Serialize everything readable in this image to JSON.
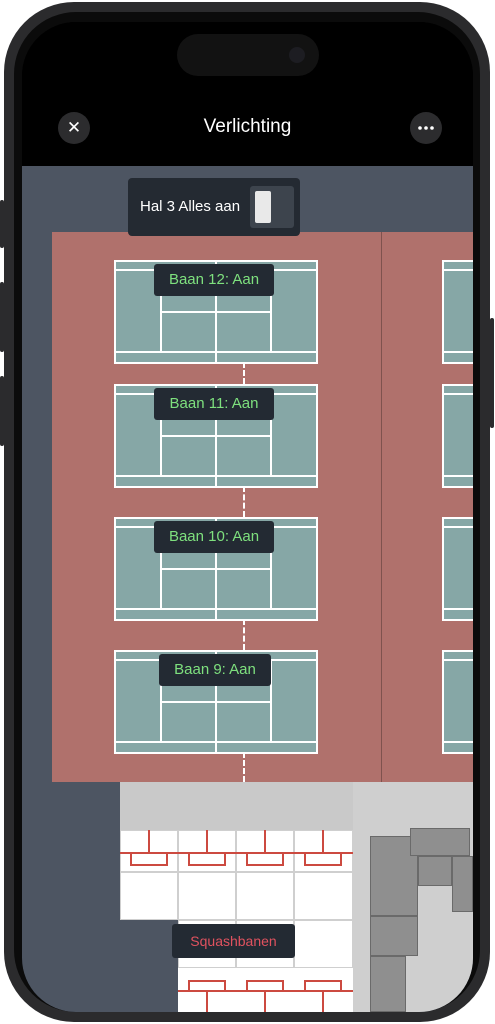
{
  "header": {
    "title": "Verlichting",
    "close_icon": "close-icon",
    "more_icon": "more-icon"
  },
  "hall_toggle": {
    "label": "Hal 3 Alles aan",
    "state": "on"
  },
  "courts": [
    {
      "label": "Baan 12:  Aan"
    },
    {
      "label": "Baan 11:  Aan"
    },
    {
      "label": "Baan 10:  Aan"
    },
    {
      "label": "Baan 9:  Aan"
    }
  ],
  "squash": {
    "label": "Squashbanen"
  },
  "colors": {
    "court_on_text": "#7ee07e",
    "squash_text": "#e0525f",
    "hall_floor": "#b0716c",
    "court_surface": "#86a7a6",
    "map_background": "#4d5562"
  }
}
